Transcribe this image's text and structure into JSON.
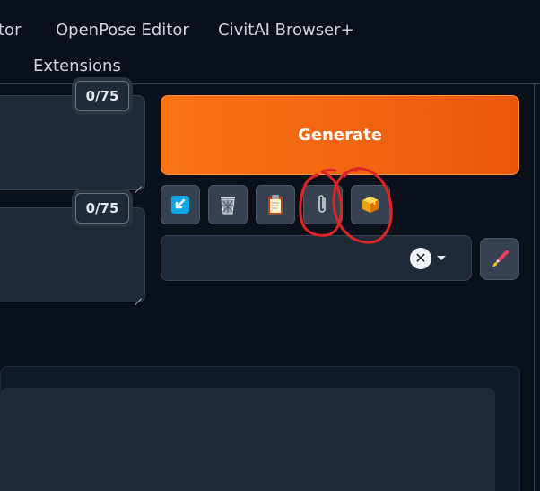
{
  "tabs": {
    "tab1": "tor",
    "tab2": "OpenPose Editor",
    "tab3": "CivitAI Browser+",
    "tab4": "Extensions"
  },
  "prompt": {
    "positive_counter": "0/75",
    "negative_counter": "0/75"
  },
  "generate": {
    "label": "Generate"
  },
  "tools": [
    {
      "name": "read-generation-parameters",
      "icon": "arrow-down-left-icon"
    },
    {
      "name": "clear-prompt",
      "icon": "trash-icon"
    },
    {
      "name": "apply-styles",
      "icon": "clipboard-icon"
    },
    {
      "name": "paperclip",
      "icon": "paperclip-icon"
    },
    {
      "name": "box",
      "icon": "package-icon"
    }
  ],
  "styles": {
    "clear_symbol": "✕",
    "edit_icon": "paint-brush-icon"
  },
  "colors": {
    "accent": "#f97316",
    "annotation": "#dc2626",
    "background": "#0b0f19"
  }
}
